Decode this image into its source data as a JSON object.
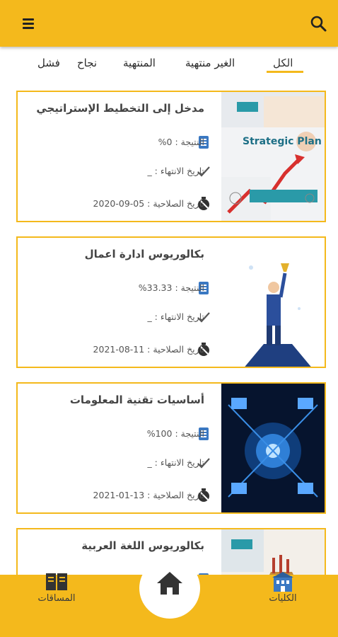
{
  "header": {
    "menu_icon": "menu-icon",
    "search_icon": "search-icon",
    "bg_color": "#f4b91c"
  },
  "tabs": [
    {
      "label": "الكل",
      "active": true
    },
    {
      "label": "الغير منتهية",
      "active": false
    },
    {
      "label": "المنتهية",
      "active": false
    },
    {
      "label": "نجاح",
      "active": false
    },
    {
      "label": "فشل",
      "active": false
    }
  ],
  "courses": [
    {
      "title": "مدخل إلى التخطيط الإستراتيجي",
      "result": "النتيجة : 0%",
      "end_date": "تاريخ الانتهاء : _",
      "expiry": "تاريخ الصلاحية : 05-09-2020",
      "image_text": "Strategic Plan"
    },
    {
      "title": "بكالوريوس ادارة اعمال",
      "result": "النتيجة : 33.33%",
      "end_date": "تاريخ الانتهاء : _",
      "expiry": "تاريخ الصلاحية : 11-08-2021"
    },
    {
      "title": "أساسيات تقنية المعلومات",
      "result": "النتيجة : 100%",
      "end_date": "تاريخ الانتهاء : _",
      "expiry": "تاريخ الصلاحية : 13-01-2021"
    },
    {
      "title": "بكالوريوس اللغة العربية",
      "result": "",
      "end_date": "",
      "expiry": ""
    }
  ],
  "bottom_nav": {
    "colleges": "الكليات",
    "courses": "المساقات",
    "home_icon": "home-icon"
  },
  "colors": {
    "accent": "#f4b91c",
    "icon_blue": "#3a78c2",
    "text": "#444444"
  }
}
